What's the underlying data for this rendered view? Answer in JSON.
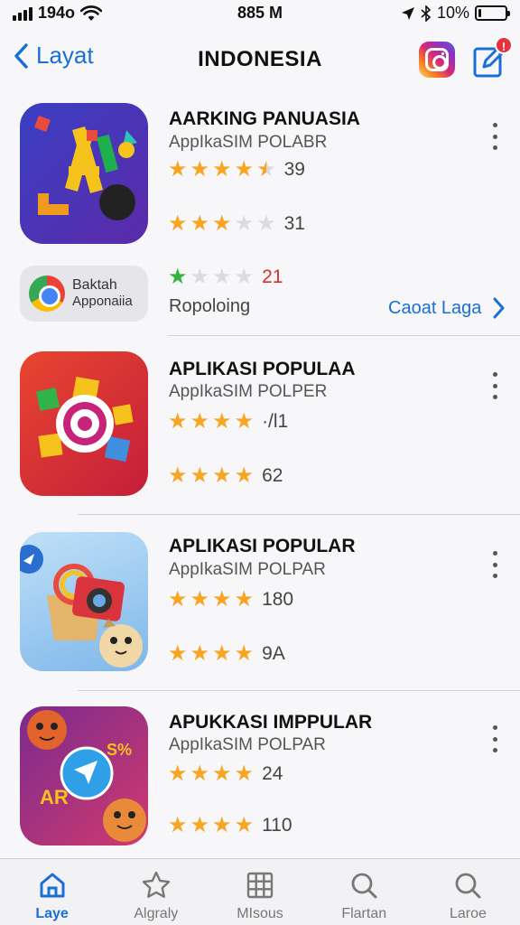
{
  "status_bar": {
    "carrier": "194o",
    "time": "885 M",
    "battery": "10%",
    "battery_level": 0.1
  },
  "nav": {
    "back_label": "Layat",
    "title": "INDONESIA",
    "notification_count": "!"
  },
  "apps": [
    {
      "title": "AARKING PANUASIA",
      "subtitle": "AppIkaSIM POLABR",
      "ratings": [
        {
          "stars": 4,
          "count": "39"
        },
        {
          "stars": 3,
          "count": "31"
        },
        {
          "stars": 1,
          "count": "21"
        }
      ]
    },
    {
      "title": "APLIKASI POPULAA",
      "subtitle": "AppIkaSIM POLPER",
      "ratings": [
        {
          "stars": 4,
          "count": "·/l1"
        },
        {
          "stars": 4,
          "count": "62"
        }
      ]
    },
    {
      "title": "APLIKASI POPULAR",
      "subtitle": "AppIkaSIM POLPAR",
      "ratings": [
        {
          "stars": 4,
          "count": "180"
        },
        {
          "stars": 4,
          "count": "9A"
        }
      ]
    },
    {
      "title": "APUKKASI IMPPULAR",
      "subtitle": "AppIkaSIM POLPAR",
      "ratings": [
        {
          "stars": 4,
          "count": "24"
        },
        {
          "stars": 4,
          "count": "110"
        }
      ]
    }
  ],
  "banner": {
    "line1": "Baktah",
    "line2": "Apponaiia"
  },
  "sub_label": "Ropoloing",
  "link_label": "Caoat Laga",
  "icon_texts": {
    "app4_left": "AR",
    "app4_right": "S%"
  },
  "tabs": [
    {
      "label": "Laye",
      "icon": "home-icon"
    },
    {
      "label": "Algraly",
      "icon": "star-icon"
    },
    {
      "label": "MIsous",
      "icon": "grid-icon"
    },
    {
      "label": "Flartan",
      "icon": "search-icon"
    },
    {
      "label": "Laroe",
      "icon": "search-icon"
    }
  ],
  "colors": {
    "accent": "#1a6fd6",
    "star": "#f6a623",
    "star_empty": "#dcdce0",
    "star_green": "#34b33b",
    "badge": "#e8323b"
  }
}
